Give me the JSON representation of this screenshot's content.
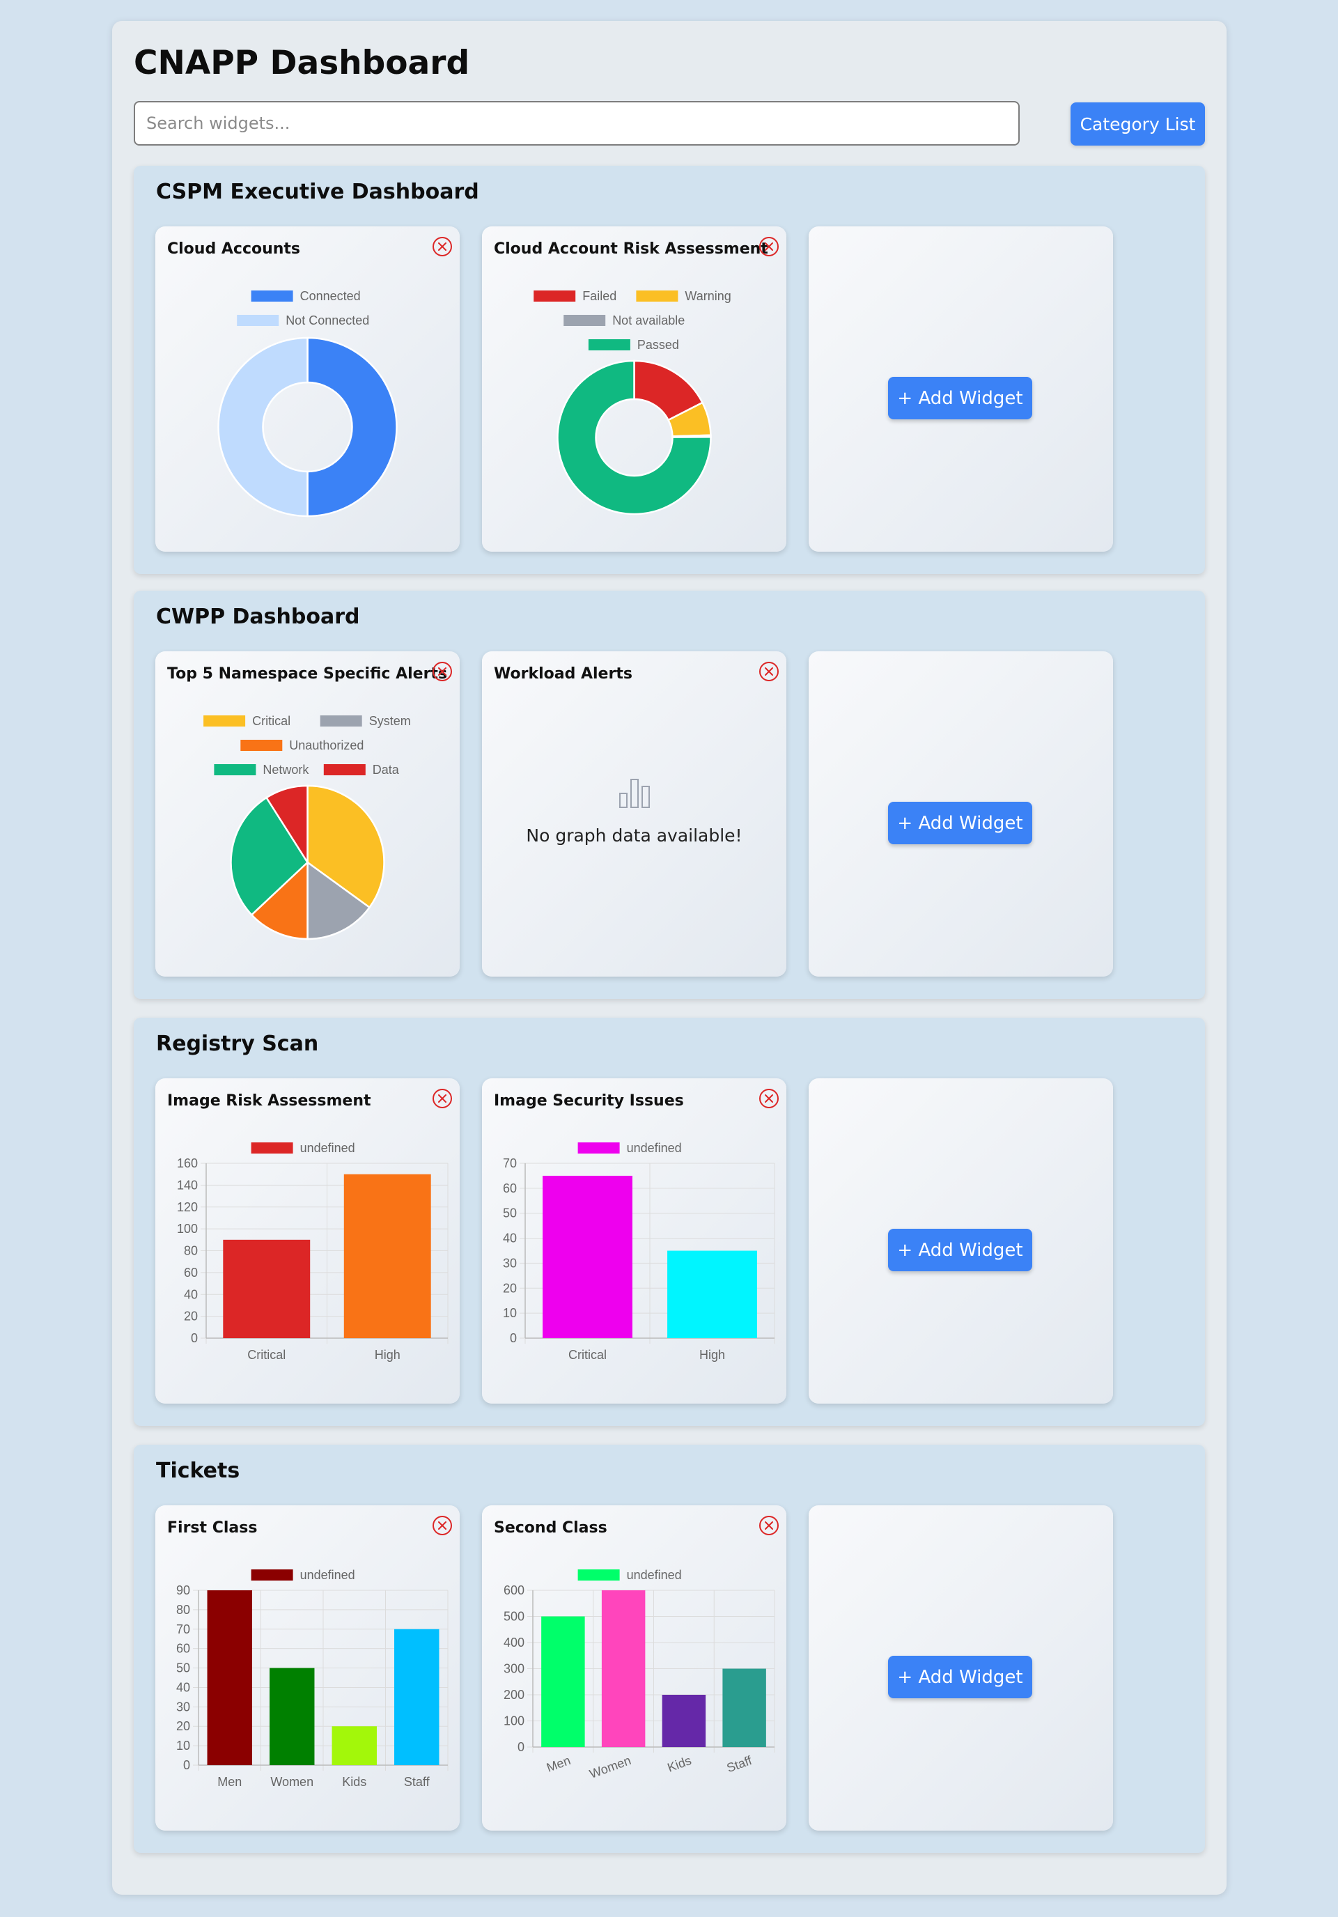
{
  "app": {
    "title": "CNAPP Dashboard",
    "search": {
      "placeholder": "Search widgets...",
      "value": ""
    },
    "category_button": "Category List",
    "add_widget_label": "+ Add Widget",
    "remove_icon": "close-circle-icon",
    "accent_color": "#3b82f6"
  },
  "sections": [
    {
      "title": "CSPM Executive Dashboard",
      "widgets": [
        {
          "title": "Cloud Accounts",
          "chart_data": {
            "type": "pie",
            "variant": "doughnut",
            "legend": "top",
            "labels": [
              "Connected",
              "Not Connected"
            ],
            "values": [
              2,
              2
            ],
            "colors": [
              "#3b82f6",
              "#bfdbfe"
            ]
          }
        },
        {
          "title": "Cloud Account Risk Assessment",
          "chart_data": {
            "type": "pie",
            "variant": "doughnut",
            "legend": "top",
            "labels": [
              "Failed",
              "Warning",
              "Not available",
              "Passed"
            ],
            "values": [
              1689,
              681,
              36,
              7253
            ],
            "colors": [
              "#dc2626",
              "#fbbf24",
              "#9ca3af",
              "#10b981"
            ]
          }
        }
      ]
    },
    {
      "title": "CWPP Dashboard",
      "widgets": [
        {
          "title": "Top 5 Namespace Specific Alerts",
          "chart_data": {
            "type": "pie",
            "legend": "top",
            "labels": [
              "Critical",
              "System",
              "Unauthorized",
              "Network",
              "Data"
            ],
            "values": [
              35,
              15,
              13,
              28,
              9
            ],
            "colors": [
              "#fbbf24",
              "#9ca3af",
              "#f97316",
              "#10b981",
              "#dc2626"
            ]
          }
        },
        {
          "title": "Workload Alerts",
          "no_data_icon": "bar-chart-icon",
          "no_data_text": "No graph data available!"
        }
      ]
    },
    {
      "title": "Registry Scan",
      "widgets": [
        {
          "title": "Image Risk Assessment",
          "chart_data": {
            "type": "bar",
            "legend": "top",
            "series_label": "undefined",
            "categories": [
              "Critical",
              "High"
            ],
            "values": [
              90,
              150
            ],
            "colors": [
              "#dc2626",
              "#f97316"
            ],
            "ylim": [
              0,
              160
            ],
            "ystep": 20,
            "grid": true
          }
        },
        {
          "title": "Image Security Issues",
          "chart_data": {
            "type": "bar",
            "legend": "top",
            "series_label": "undefined",
            "categories": [
              "Critical",
              "High"
            ],
            "values": [
              65,
              35
            ],
            "colors": [
              "#ee00ee",
              "#00f5ff"
            ],
            "ylim": [
              0,
              70
            ],
            "ystep": 10,
            "grid": true
          }
        }
      ]
    },
    {
      "title": "Tickets",
      "widgets": [
        {
          "title": "First Class",
          "chart_data": {
            "type": "bar",
            "legend": "top",
            "series_label": "undefined",
            "categories": [
              "Men",
              "Women",
              "Kids",
              "Staff"
            ],
            "values": [
              90,
              50,
              20,
              70
            ],
            "colors": [
              "#8b0000",
              "#008000",
              "#a3f70a",
              "#00bfff"
            ],
            "ylim": [
              0,
              90
            ],
            "ystep": 10,
            "grid": true
          }
        },
        {
          "title": "Second Class",
          "chart_data": {
            "type": "bar",
            "legend": "top",
            "series_label": "undefined",
            "categories": [
              "Men",
              "Women",
              "Kids",
              "Staff"
            ],
            "values": [
              500,
              600,
              200,
              300
            ],
            "colors": [
              "#00ff6a",
              "#ff45bc",
              "#6528a8",
              "#2a9d8f"
            ],
            "ylim": [
              0,
              600
            ],
            "ystep": 100,
            "grid": true,
            "tick_rotation": "slanted"
          }
        }
      ]
    }
  ]
}
